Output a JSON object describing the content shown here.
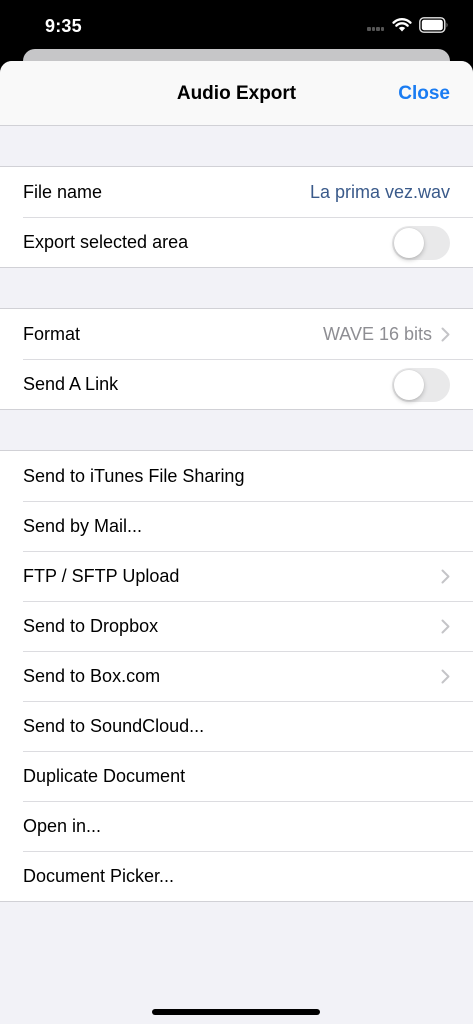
{
  "status": {
    "time": "9:35",
    "icons": [
      "signal-icon",
      "wifi-icon",
      "battery-icon"
    ]
  },
  "nav": {
    "title": "Audio Export",
    "close_label": "Close",
    "accent_color": "#1a7cf2"
  },
  "file_section": {
    "file_name_label": "File name",
    "file_name_value": "La prima vez.wav",
    "export_selected_label": "Export selected area",
    "export_selected_on": false
  },
  "format_section": {
    "format_label": "Format",
    "format_value": "WAVE 16 bits",
    "send_link_label": "Send A Link",
    "send_link_on": false
  },
  "actions": [
    {
      "label": "Send to iTunes File Sharing",
      "chevron": false
    },
    {
      "label": "Send by Mail...",
      "chevron": false
    },
    {
      "label": "FTP / SFTP Upload",
      "chevron": true
    },
    {
      "label": "Send to Dropbox",
      "chevron": true
    },
    {
      "label": "Send to Box.com",
      "chevron": true
    },
    {
      "label": "Send to SoundCloud...",
      "chevron": false
    },
    {
      "label": "Duplicate Document",
      "chevron": false
    },
    {
      "label": "Open in...",
      "chevron": false
    },
    {
      "label": "Document Picker...",
      "chevron": false
    }
  ]
}
